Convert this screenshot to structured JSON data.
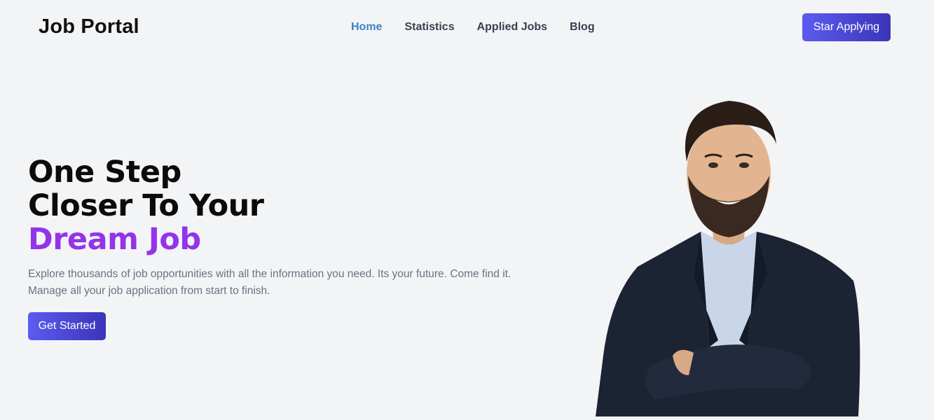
{
  "header": {
    "logo": "Job Portal",
    "nav": [
      {
        "label": "Home",
        "active": true
      },
      {
        "label": "Statistics",
        "active": false
      },
      {
        "label": "Applied Jobs",
        "active": false
      },
      {
        "label": "Blog",
        "active": false
      }
    ],
    "cta_label": "Star Applying"
  },
  "hero": {
    "title_line1": "One Step",
    "title_line2": "Closer To Your",
    "title_accent": "Dream Job",
    "description": "Explore thousands of job opportunities with all the information you need. Its your future. Come find it. Manage all your job application from start to finish.",
    "cta_label": "Get Started"
  },
  "colors": {
    "background": "#f3f4f6",
    "accent_purple": "#9333ea",
    "nav_active": "#3b82c4",
    "button_gradient_start": "#5b5cf0",
    "button_gradient_end": "#3b34b8"
  }
}
